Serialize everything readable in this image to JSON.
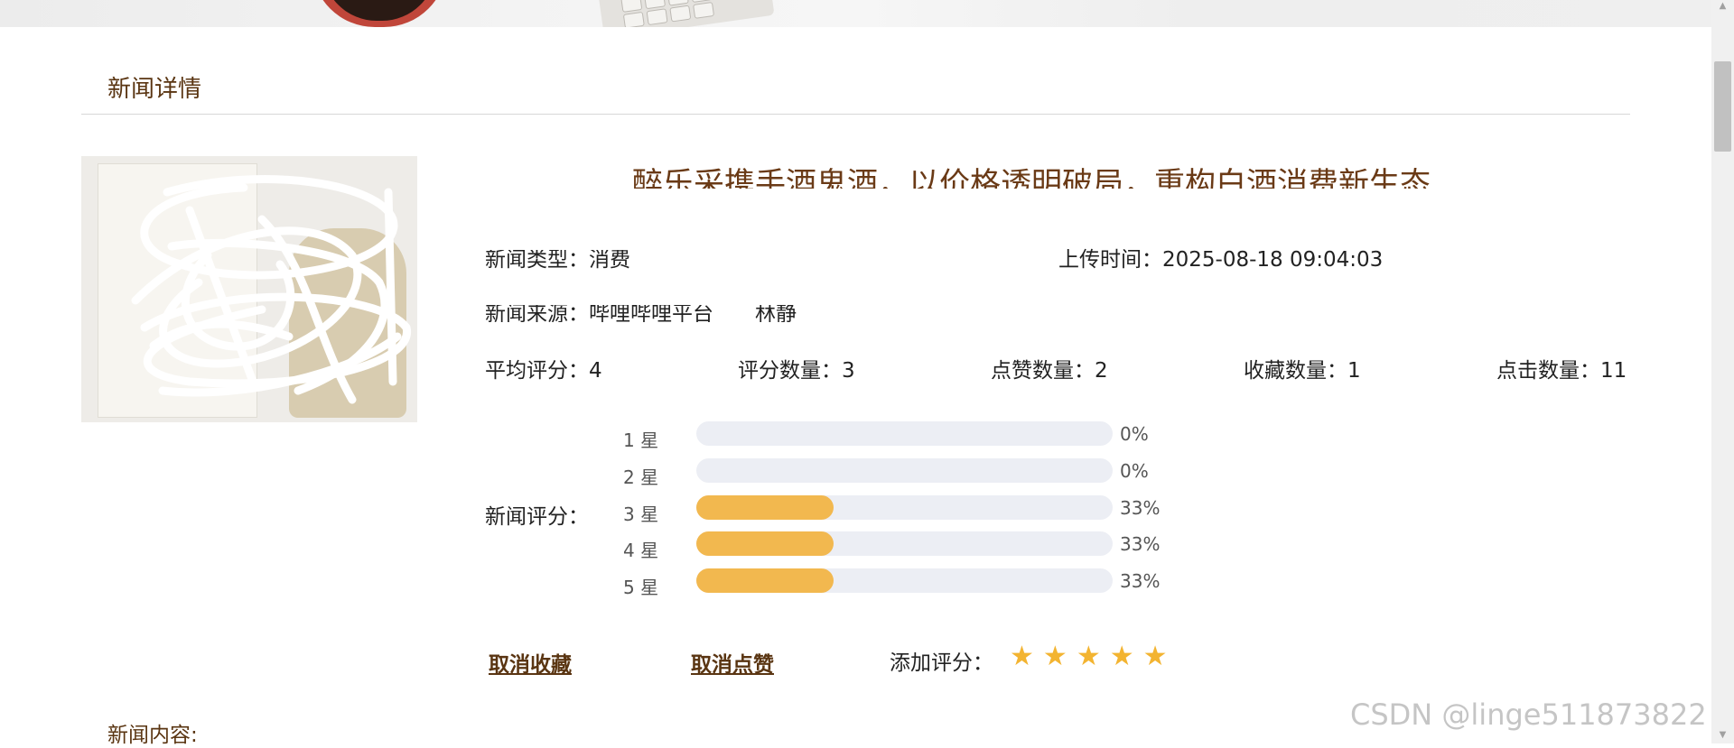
{
  "section": {
    "title": "新闻详情",
    "content_label": "新闻内容:"
  },
  "news": {
    "title": "醉乐采携手酒鬼酒，以价格透明破局，重构白酒消费新生态",
    "type_label": "新闻类型：",
    "type_value": "消费",
    "upload_label": "上传时间：",
    "upload_value": "2025-08-18 09:04:03",
    "source_label": "新闻来源：",
    "source_value": "哔哩哔哩平台　　林静"
  },
  "stats": [
    {
      "label": "平均评分：",
      "value": "4"
    },
    {
      "label": "评分数量：",
      "value": "3"
    },
    {
      "label": "点赞数量：",
      "value": "2"
    },
    {
      "label": "收藏数量：",
      "value": "1"
    },
    {
      "label": "点击数量：",
      "value": "11"
    }
  ],
  "rating": {
    "label": "新闻评分：",
    "rows": [
      {
        "label": "1 星",
        "pct_text": "0%",
        "fraction": 0
      },
      {
        "label": "2 星",
        "pct_text": "0%",
        "fraction": 0
      },
      {
        "label": "3 星",
        "pct_text": "33%",
        "fraction": 0.33
      },
      {
        "label": "4 星",
        "pct_text": "33%",
        "fraction": 0.33
      },
      {
        "label": "5 星",
        "pct_text": "33%",
        "fraction": 0.33
      }
    ]
  },
  "actions": {
    "unfavorite": "取消收藏",
    "unlike": "取消点赞",
    "add_rating_label": "添加评分：",
    "star_glyph": "★",
    "star_count": 5
  },
  "watermark": "CSDN @linge511873822",
  "colors": {
    "accent_brown": "#5a3512",
    "bar_fill": "#f2b84f",
    "bar_track": "#eceef4",
    "star": "#f3b431"
  }
}
